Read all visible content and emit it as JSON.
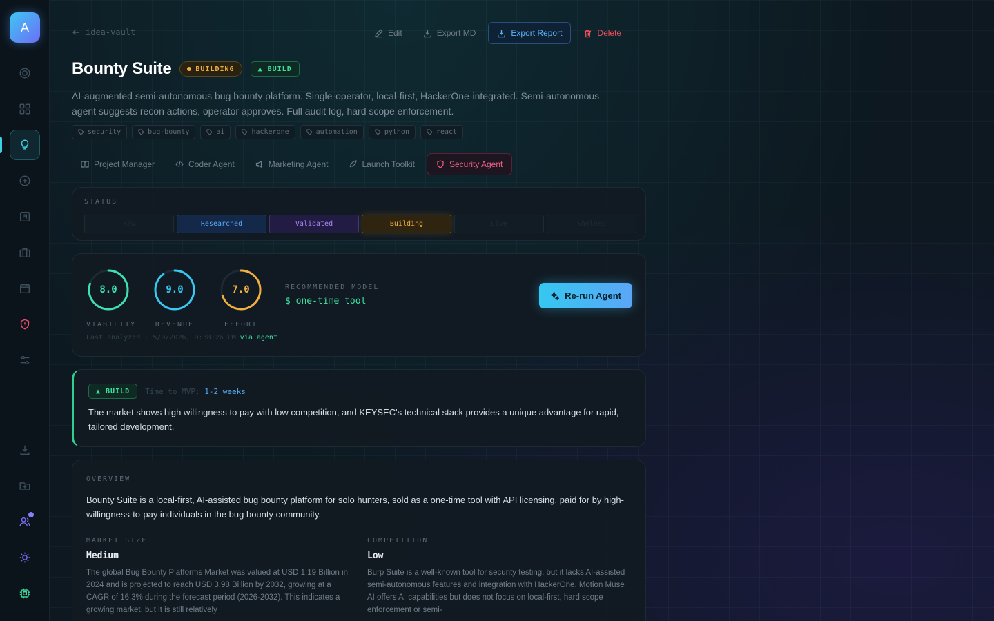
{
  "app": {
    "logo_letter": "A"
  },
  "back": {
    "label": "idea-vault"
  },
  "toolbar": {
    "edit": "Edit",
    "export_md": "Export MD",
    "export_report": "Export Report",
    "delete": "Delete"
  },
  "idea": {
    "title": "Bounty Suite",
    "status_badge": "BUILDING",
    "verdict_badge": "▲ BUILD",
    "description": "AI-augmented semi-autonomous bug bounty platform. Single-operator, local-first, HackerOne-integrated. Semi-autonomous agent suggests recon actions, operator approves. Full audit log, hard scope enforcement.",
    "tags": [
      "security",
      "bug-bounty",
      "ai",
      "hackerone",
      "automation",
      "python",
      "react"
    ]
  },
  "agents": {
    "tabs": [
      "Project Manager",
      "Coder Agent",
      "Marketing Agent",
      "Launch Toolkit",
      "Security Agent"
    ],
    "active": "Security Agent"
  },
  "status": {
    "label": "STATUS",
    "stages": [
      "Raw",
      "Researched",
      "Validated",
      "Building",
      "Live",
      "Shelved"
    ],
    "current": "Building"
  },
  "scores": {
    "viability": {
      "label": "VIABILITY",
      "value": "8.0",
      "fraction": 0.8,
      "color": "#3ee0b0"
    },
    "revenue": {
      "label": "REVENUE",
      "value": "9.0",
      "fraction": 0.9,
      "color": "#38c8f0"
    },
    "effort": {
      "label": "EFFORT",
      "value": "7.0",
      "fraction": 0.7,
      "color": "#f0b040"
    },
    "recommended_label": "RECOMMENDED MODEL",
    "recommended_value": "$ one-time tool",
    "rerun_label": "Re-run Agent",
    "analyzed_text": "Last analyzed · 5/9/2026, 9:38:26 PM",
    "analyzed_via": "via agent"
  },
  "verdict": {
    "badge": "▲ BUILD",
    "mvp_label": "Time to MVP:",
    "mvp_value": "1-2 weeks",
    "text": "The market shows high willingness to pay with low competition, and KEYSEC's technical stack provides a unique advantage for rapid, tailored development."
  },
  "overview": {
    "label": "OVERVIEW",
    "text": "Bounty Suite is a local-first, AI-assisted bug bounty platform for solo hunters, sold as a one-time tool with API licensing, paid for by high-willingness-to-pay individuals in the bug bounty community.",
    "market_size": {
      "label": "MARKET SIZE",
      "value": "Medium",
      "text": "The global Bug Bounty Platforms Market was valued at USD 1.19 Billion in 2024 and is projected to reach USD 3.98 Billion by 2032, growing at a CAGR of 16.3% during the forecast period (2026-2032). This indicates a growing market, but it is still relatively"
    },
    "competition": {
      "label": "COMPETITION",
      "value": "Low",
      "text": "Burp Suite is a well-known tool for security testing, but it lacks AI-assisted semi-autonomous features and integration with HackerOne. Motion Muse AI offers AI capabilities but does not focus on local-first, hard scope enforcement or semi-"
    }
  }
}
